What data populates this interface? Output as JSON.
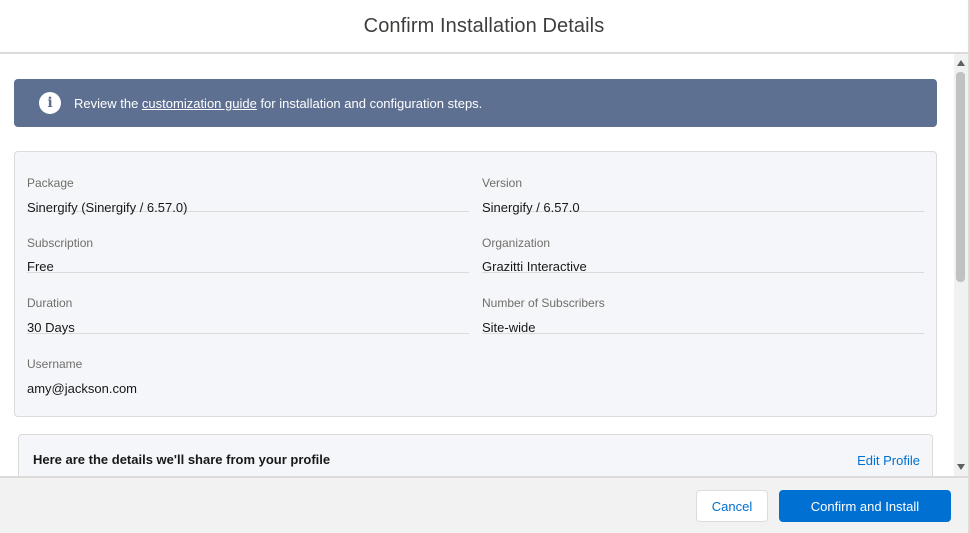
{
  "modal": {
    "title": "Confirm Installation Details"
  },
  "banner": {
    "icon": "info-icon",
    "text_before": "Review the ",
    "link_text": "customization guide",
    "text_after": " for installation and configuration steps."
  },
  "details": {
    "package_label": "Package",
    "package_value": "Sinergify (Sinergify / 6.57.0)",
    "version_label": "Version",
    "version_value": "Sinergify / 6.57.0",
    "subscription_label": "Subscription",
    "subscription_value": "Free",
    "organization_label": "Organization",
    "organization_value": "Grazitti Interactive",
    "duration_label": "Duration",
    "duration_value": "30 Days",
    "subscribers_label": "Number of Subscribers",
    "subscribers_value": "Site-wide",
    "username_label": "Username",
    "username_value": "amy@jackson.com"
  },
  "profile_share": {
    "title": "Here are the details we'll share from your profile",
    "edit_label": "Edit Profile"
  },
  "footer": {
    "cancel_label": "Cancel",
    "confirm_label": "Confirm and Install"
  },
  "colors": {
    "banner_bg": "#5e7091",
    "brand_blue": "#0070d2",
    "card_bg": "#f4f6f9",
    "border": "#dddbda"
  }
}
